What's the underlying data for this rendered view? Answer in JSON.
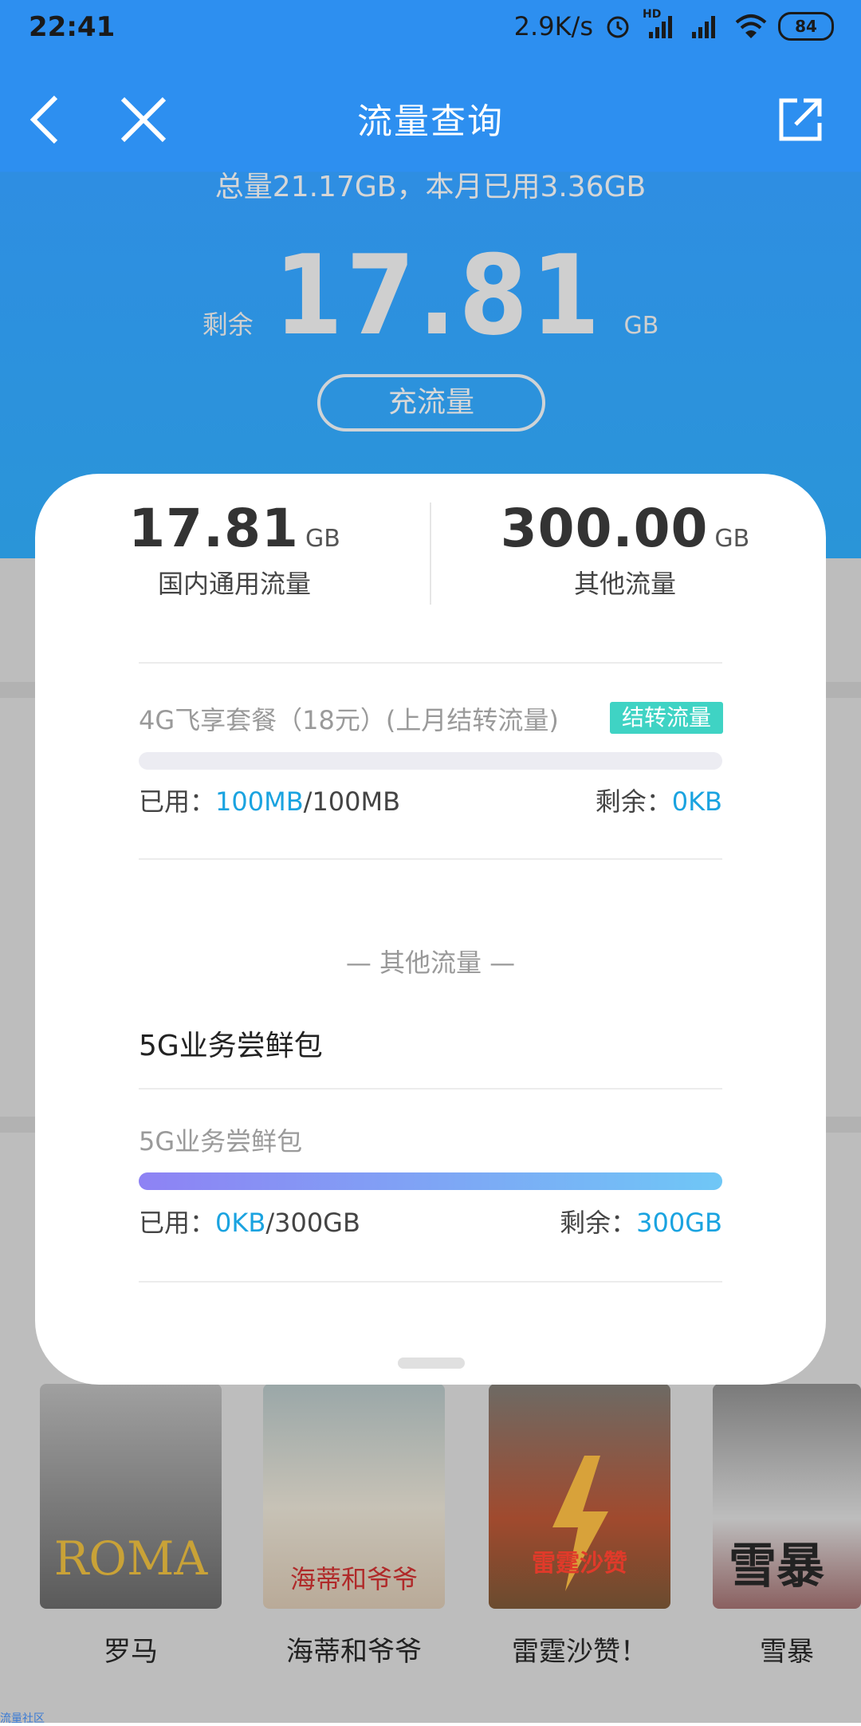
{
  "status_bar": {
    "time": "22:41",
    "net_speed": "2.9K/s",
    "hd_label": "HD",
    "battery": "84"
  },
  "nav": {
    "title": "流量查询"
  },
  "summary": {
    "total_text": "总量21.17GB，本月已用3.36GB",
    "remaining_label": "剩余",
    "remaining_value": "17.81",
    "remaining_unit": "GB",
    "recharge_button": "充流量"
  },
  "card": {
    "domestic": {
      "value": "17.81",
      "unit": "GB",
      "label": "国内通用流量"
    },
    "other": {
      "value": "300.00",
      "unit": "GB",
      "label": "其他流量"
    },
    "package1": {
      "title": "4G飞享套餐（18元）(上月结转流量)",
      "tag": "结转流量",
      "used_label": "已用：",
      "used": "100MB",
      "total": "/100MB",
      "remain_label": "剩余：",
      "remain": "0KB",
      "remaining_fraction": 0.0
    },
    "other_section_title": "— 其他流量 —",
    "group_title": "5G业务尝鲜包",
    "package2": {
      "title": "5G业务尝鲜包",
      "used_label": "已用：",
      "used": "0KB",
      "total": "/300GB",
      "remain_label": "剩余：",
      "remain": "300GB",
      "remaining_fraction": 1.0
    }
  },
  "movies": [
    {
      "title": "罗马",
      "poster_text": "ROMA"
    },
    {
      "title": "海蒂和爷爷",
      "poster_text": "海蒂和爷爷"
    },
    {
      "title": "雷霆沙赞！",
      "poster_text": "雷霆沙赞"
    },
    {
      "title": "雪暴",
      "poster_text": "雪暴"
    }
  ],
  "footer": {
    "link": "流量社区"
  },
  "colors": {
    "primary_blue": "#2d8ff0",
    "accent_blue": "#1aa3e0",
    "tag_teal": "#3fd3c4"
  }
}
